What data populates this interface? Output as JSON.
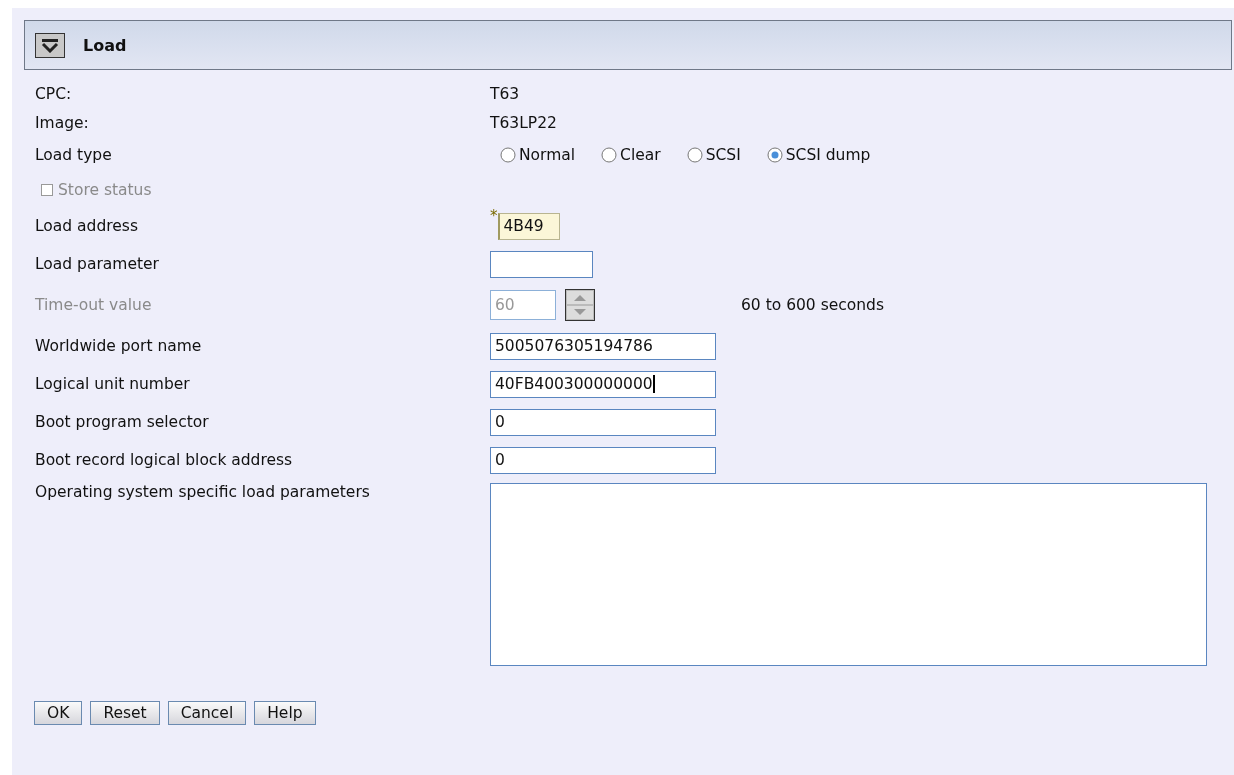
{
  "panel": {
    "title": "Load",
    "expanded": true
  },
  "rows": [
    {
      "kind": "info",
      "label": "CPC:",
      "value": "T63"
    },
    {
      "kind": "info",
      "label": "Image:",
      "value": "T63LP22"
    },
    {
      "kind": "radio",
      "label": "Load type",
      "options": [
        {
          "label": "Normal",
          "selected": false
        },
        {
          "label": "Clear",
          "selected": false
        },
        {
          "label": "SCSI",
          "selected": false
        },
        {
          "label": "SCSI dump",
          "selected": true
        }
      ]
    },
    {
      "kind": "checkbox",
      "label": "Store status",
      "checked": false,
      "disabled": true
    },
    {
      "kind": "tiny",
      "label": "Load address",
      "value": "4B49",
      "required_mark": "*"
    },
    {
      "kind": "short",
      "label": "Load parameter"
    },
    {
      "kind": "spinner",
      "label": "Time-out value",
      "value": "60",
      "disabled": true,
      "hint": "60 to 600 seconds"
    },
    {
      "kind": "text",
      "label": "Worldwide port name",
      "value": "5005076305194786"
    },
    {
      "kind": "text",
      "label": "Logical unit number",
      "value": "40FB400300000000",
      "focused": true
    },
    {
      "kind": "text",
      "label": "Boot program selector",
      "value": "0"
    },
    {
      "kind": "text",
      "label": "Boot record logical block address",
      "value": "0"
    },
    {
      "kind": "textarea",
      "label": "Operating system specific load parameters"
    }
  ],
  "buttons": [
    "OK",
    "Reset",
    "Cancel",
    "Help"
  ]
}
